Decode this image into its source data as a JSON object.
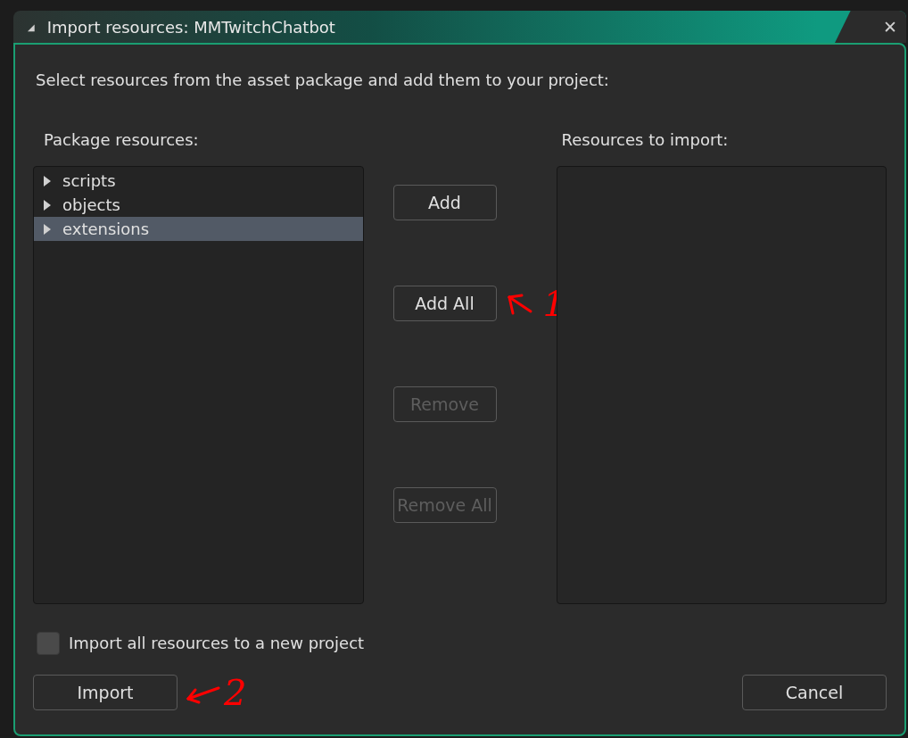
{
  "window": {
    "title": "Import resources: MMTwitchChatbot",
    "collapse_glyph": "◢",
    "close_glyph": "✕"
  },
  "instruction": "Select resources from the asset package and add them to your project:",
  "package_resources": {
    "label": "Package resources:",
    "items": [
      {
        "name": "scripts",
        "expanded": false,
        "selected": false
      },
      {
        "name": "objects",
        "expanded": false,
        "selected": false
      },
      {
        "name": "extensions",
        "expanded": false,
        "selected": true
      }
    ]
  },
  "transfer_buttons": [
    {
      "label": "Add",
      "disabled": false
    },
    {
      "label": "Add All",
      "disabled": false,
      "note": "1"
    },
    {
      "label": "Remove",
      "disabled": true
    },
    {
      "label": "Remove All",
      "disabled": true
    }
  ],
  "resources_to_import": {
    "label": "Resources to import:"
  },
  "new_project_option": {
    "label": "Import all resources to a new project",
    "checked": false
  },
  "import_button": {
    "label": "Import",
    "note": "2"
  },
  "cancel_button": {
    "label": "Cancel"
  }
}
